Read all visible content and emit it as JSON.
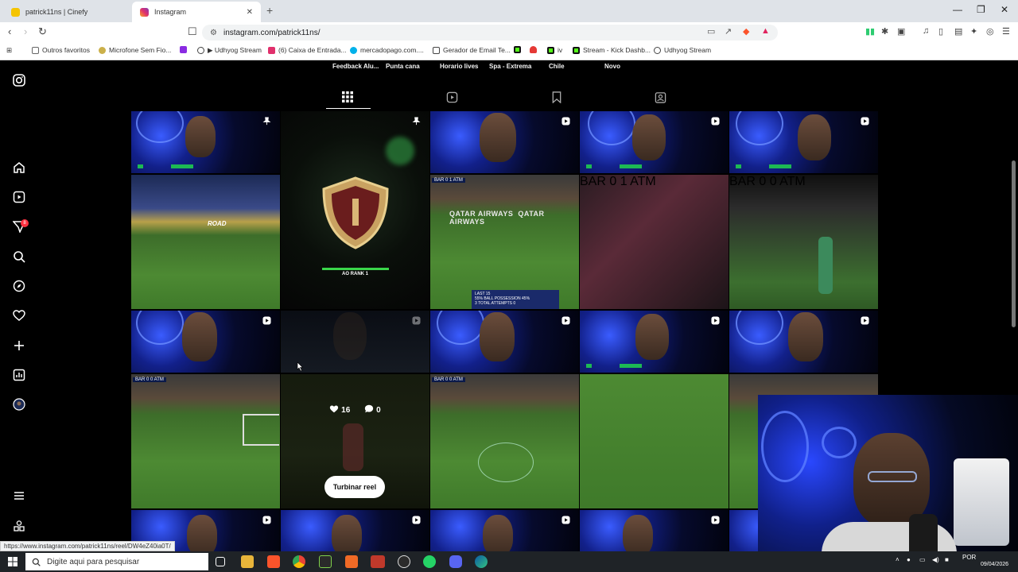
{
  "browser": {
    "tabs": [
      {
        "title": "patrick11ns | Cinefy",
        "active": false,
        "favicon_color": "#f5c400"
      },
      {
        "title": "Instagram",
        "active": true,
        "favicon_color": "#e1306c"
      }
    ],
    "url": "instagram.com/patrick11ns/",
    "bookmarks": [
      "Outros favoritos",
      "Microfone Sem Fio...",
      "▶ Udhyog Stream",
      "(6) Caixa de Entrada...",
      "mercadopago.com....",
      "Gerador de Email Te...",
      "iv",
      "Stream - Kick Dashb...",
      "Udhyog Stream"
    ],
    "status_url": "https://www.instagram.com/patrick11ns/reel/DW4eZ40ia0T/"
  },
  "instagram": {
    "notification_count": "8",
    "highlights": [
      "Feedback Alu...",
      "Punta cana",
      "Horario lives",
      "Spa - Extrema",
      "Chile",
      "Novo"
    ],
    "profile_tabs": [
      "posts-grid",
      "reels",
      "saved",
      "tagged"
    ],
    "hover_post": {
      "likes": "16",
      "comments": "0",
      "boost_label": "Turbinar reel"
    },
    "rank_caption": "AO RANK 1",
    "channel_tag": "Patrick11NS",
    "scoreboard": "BAR 0 1 ATM",
    "scoreboard_alt": "BAR 0 0 ATM",
    "stats_overlay": {
      "title": "LAST 15",
      "line1": "55%  BALL POSSESSION  45%",
      "line2": "3   TOTAL ATTEMPTS   0"
    },
    "stadium_text": "QATAR AIRWAYS",
    "board_text": "ROAD"
  },
  "taskbar": {
    "search_placeholder": "Digite aqui para pesquisar",
    "language": "POR",
    "date": "09/04/2026"
  },
  "colors": {
    "accent_ig": "#e1306c",
    "badge": "#ff3040",
    "brave": "#fb542b"
  }
}
